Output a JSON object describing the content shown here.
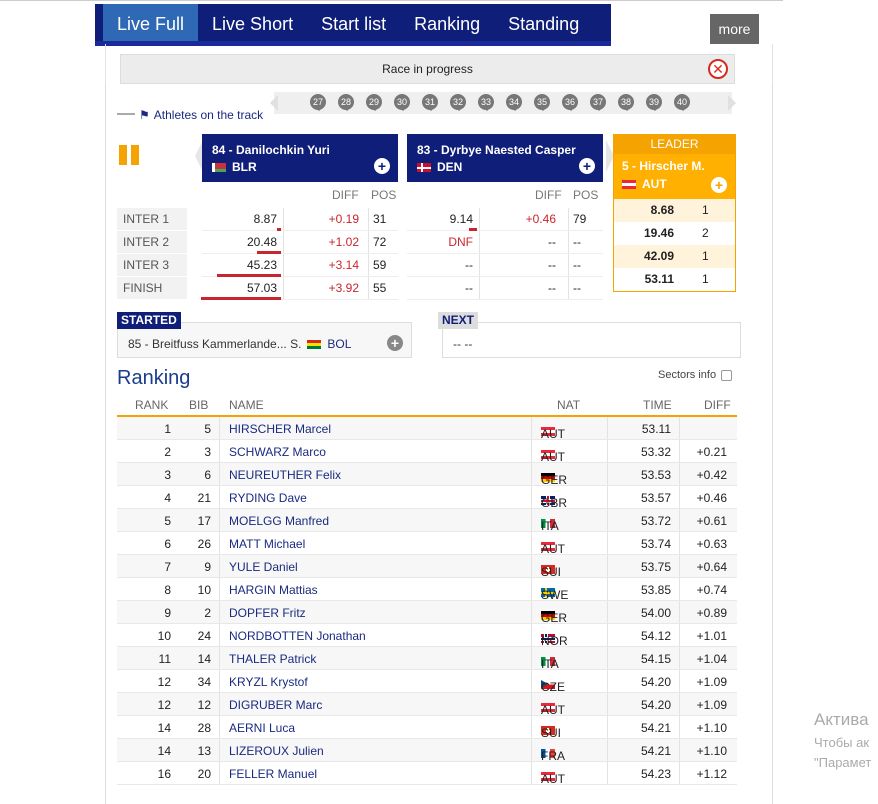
{
  "tabs": [
    {
      "label": "Live Full",
      "active": true
    },
    {
      "label": "Live Short"
    },
    {
      "label": "Start list"
    },
    {
      "label": "Ranking"
    },
    {
      "label": "Standing"
    }
  ],
  "more_label": "more",
  "race_status": "Race in progress",
  "track": {
    "label": "Athletes on the track",
    "bibs": [
      "27",
      "28",
      "29",
      "30",
      "31",
      "32",
      "33",
      "34",
      "35",
      "36",
      "37",
      "38",
      "39",
      "40"
    ]
  },
  "card1": {
    "name": "84 - Danilochkin Yuri",
    "country": "BLR"
  },
  "card2": {
    "name": "83 - Dyrbye Naested Casper",
    "country": "DEN"
  },
  "split_headers": {
    "diff": "DIFF",
    "pos": "POS"
  },
  "inter_labels": [
    "INTER 1",
    "INTER 2",
    "INTER 3",
    "FINISH"
  ],
  "card1_splits": [
    {
      "time": "8.87",
      "diff": "+0.19",
      "pos": "31",
      "bar": 0.03
    },
    {
      "time": "20.48",
      "diff": "+1.02",
      "pos": "72",
      "bar": 0.3
    },
    {
      "time": "45.23",
      "diff": "+3.14",
      "pos": "59",
      "bar": 0.8
    },
    {
      "time": "57.03",
      "diff": "+3.92",
      "pos": "55",
      "bar": 1.0
    }
  ],
  "card2_splits": [
    {
      "time": "9.14",
      "diff": "+0.46",
      "pos": "79",
      "bar": 0.1
    },
    {
      "time": "DNF",
      "diff": "--",
      "pos": "--"
    },
    {
      "time": "--",
      "diff": "--",
      "pos": "--"
    },
    {
      "time": "--",
      "diff": "--",
      "pos": "--"
    }
  ],
  "leader": {
    "title": "LEADER",
    "name": "5 - Hirscher M.",
    "country": "AUT",
    "splits": [
      {
        "time": "8.68",
        "pos": "1"
      },
      {
        "time": "19.46",
        "pos": "2"
      },
      {
        "time": "42.09",
        "pos": "1"
      },
      {
        "time": "53.11",
        "pos": "1"
      }
    ]
  },
  "started": {
    "label": "STARTED",
    "text": "85 - Breitfuss Kammerlande... S.",
    "country": "BOL"
  },
  "next": {
    "label": "NEXT",
    "text": "-- --"
  },
  "ranking": {
    "title": "Ranking",
    "sectors_label": "Sectors info",
    "headers": {
      "rank": "RANK",
      "bib": "BIB",
      "name": "NAME",
      "nat": "NAT",
      "time": "TIME",
      "diff": "DIFF"
    },
    "rows": [
      {
        "rank": "1",
        "bib": "5",
        "name": "HIRSCHER Marcel",
        "nat": "AUT",
        "time": "53.11",
        "diff": ""
      },
      {
        "rank": "2",
        "bib": "3",
        "name": "SCHWARZ Marco",
        "nat": "AUT",
        "time": "53.32",
        "diff": "+0.21"
      },
      {
        "rank": "3",
        "bib": "6",
        "name": "NEUREUTHER Felix",
        "nat": "GER",
        "time": "53.53",
        "diff": "+0.42"
      },
      {
        "rank": "4",
        "bib": "21",
        "name": "RYDING Dave",
        "nat": "GBR",
        "time": "53.57",
        "diff": "+0.46"
      },
      {
        "rank": "5",
        "bib": "17",
        "name": "MOELGG Manfred",
        "nat": "ITA",
        "time": "53.72",
        "diff": "+0.61"
      },
      {
        "rank": "6",
        "bib": "26",
        "name": "MATT Michael",
        "nat": "AUT",
        "time": "53.74",
        "diff": "+0.63"
      },
      {
        "rank": "7",
        "bib": "9",
        "name": "YULE Daniel",
        "nat": "SUI",
        "time": "53.75",
        "diff": "+0.64"
      },
      {
        "rank": "8",
        "bib": "10",
        "name": "HARGIN Mattias",
        "nat": "SWE",
        "time": "53.85",
        "diff": "+0.74"
      },
      {
        "rank": "9",
        "bib": "2",
        "name": "DOPFER Fritz",
        "nat": "GER",
        "time": "54.00",
        "diff": "+0.89"
      },
      {
        "rank": "10",
        "bib": "24",
        "name": "NORDBOTTEN Jonathan",
        "nat": "NOR",
        "time": "54.12",
        "diff": "+1.01"
      },
      {
        "rank": "11",
        "bib": "14",
        "name": "THALER Patrick",
        "nat": "ITA",
        "time": "54.15",
        "diff": "+1.04"
      },
      {
        "rank": "12",
        "bib": "34",
        "name": "KRYZL Krystof",
        "nat": "CZE",
        "time": "54.20",
        "diff": "+1.09"
      },
      {
        "rank": "12",
        "bib": "12",
        "name": "DIGRUBER Marc",
        "nat": "AUT",
        "time": "54.20",
        "diff": "+1.09"
      },
      {
        "rank": "14",
        "bib": "28",
        "name": "AERNI Luca",
        "nat": "SUI",
        "time": "54.21",
        "diff": "+1.10"
      },
      {
        "rank": "14",
        "bib": "13",
        "name": "LIZEROUX Julien",
        "nat": "FRA",
        "time": "54.21",
        "diff": "+1.10"
      },
      {
        "rank": "16",
        "bib": "20",
        "name": "FELLER Manuel",
        "nat": "AUT",
        "time": "54.23",
        "diff": "+1.12"
      }
    ]
  },
  "activation": {
    "line1": "Актива",
    "line2": "Чтобы ак",
    "line3": "\"Парамет"
  }
}
